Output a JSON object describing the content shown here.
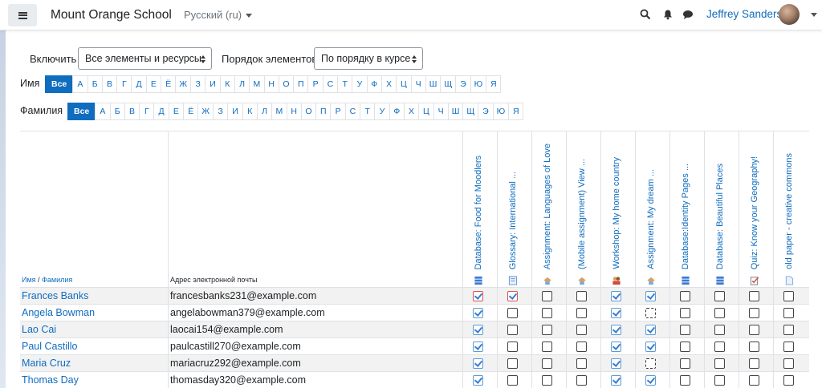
{
  "header": {
    "site_name": "Mount Orange School",
    "language": "Русский (ru)",
    "user_name": "Jeffrey Sanders",
    "icons": [
      "menu-icon",
      "search-icon",
      "bell-icon",
      "chat-icon"
    ]
  },
  "filters": {
    "include_label": "Включить",
    "include_value": "Все элементы и ресурсы",
    "order_label": "Порядок элементов",
    "order_value": "По порядку в курсе"
  },
  "firstname_filter": {
    "label": "Имя",
    "letters": [
      "Все",
      "А",
      "Б",
      "В",
      "Г",
      "Д",
      "Е",
      "Ё",
      "Ж",
      "З",
      "И",
      "К",
      "Л",
      "М",
      "Н",
      "О",
      "П",
      "Р",
      "С",
      "Т",
      "У",
      "Ф",
      "Х",
      "Ц",
      "Ч",
      "Ш",
      "Щ",
      "Э",
      "Ю",
      "Я"
    ],
    "active": "Все"
  },
  "lastname_filter": {
    "label": "Фамилия",
    "letters": [
      "Все",
      "А",
      "Б",
      "В",
      "Г",
      "Д",
      "Е",
      "Ё",
      "Ж",
      "З",
      "И",
      "К",
      "Л",
      "М",
      "Н",
      "О",
      "П",
      "Р",
      "С",
      "Т",
      "У",
      "Ф",
      "Х",
      "Ц",
      "Ч",
      "Ш",
      "Щ",
      "Э",
      "Ю",
      "Я"
    ],
    "active": "Все"
  },
  "table": {
    "col_name_first": "Имя",
    "col_name_sep": " / ",
    "col_name_last": "Фамилия",
    "col_email": "Адрес электронной почты",
    "activities": [
      {
        "title": "Database: Food for Moodlers",
        "icon": "database-icon"
      },
      {
        "title": "Glossary: International ...",
        "icon": "glossary-icon"
      },
      {
        "title": "Assignment: Languages of Love",
        "icon": "assignment-icon"
      },
      {
        "title": "(Mobile assignment) View ...",
        "icon": "assignment-icon"
      },
      {
        "title": "Workshop: My home country",
        "icon": "workshop-icon"
      },
      {
        "title": "Assignment: My dream ...",
        "icon": "assignment-icon"
      },
      {
        "title": "Database:Identity Pages ...",
        "icon": "database-icon"
      },
      {
        "title": "Database: Beautiful Places",
        "icon": "database-icon"
      },
      {
        "title": "Quiz: Know your Geography!",
        "icon": "quiz-icon"
      },
      {
        "title": "old paper - creative commons",
        "icon": "file-icon"
      }
    ],
    "rows": [
      {
        "name": "Frances Banks",
        "email": "francesbanks231@example.com",
        "status": [
          "fail",
          "fail",
          "empty",
          "empty",
          "done",
          "done",
          "empty",
          "empty",
          "empty",
          "empty"
        ]
      },
      {
        "name": "Angela Bowman",
        "email": "angelabowman379@example.com",
        "status": [
          "done",
          "empty",
          "empty",
          "empty",
          "done",
          "dashed",
          "empty",
          "empty",
          "empty",
          "empty"
        ]
      },
      {
        "name": "Lao Cai",
        "email": "laocai154@example.com",
        "status": [
          "done",
          "empty",
          "empty",
          "empty",
          "done",
          "done",
          "empty",
          "empty",
          "empty",
          "empty"
        ]
      },
      {
        "name": "Paul Castillo",
        "email": "paulcastill270@example.com",
        "status": [
          "done",
          "empty",
          "empty",
          "empty",
          "done",
          "done",
          "empty",
          "empty",
          "empty",
          "empty"
        ]
      },
      {
        "name": "Maria Cruz",
        "email": "mariacruz292@example.com",
        "status": [
          "done",
          "empty",
          "empty",
          "empty",
          "done",
          "dashed",
          "empty",
          "empty",
          "empty",
          "empty"
        ]
      },
      {
        "name": "Thomas Day",
        "email": "thomasday320@example.com",
        "status": [
          "done",
          "empty",
          "empty",
          "empty",
          "done",
          "done",
          "empty",
          "empty",
          "empty",
          "empty"
        ]
      }
    ]
  }
}
